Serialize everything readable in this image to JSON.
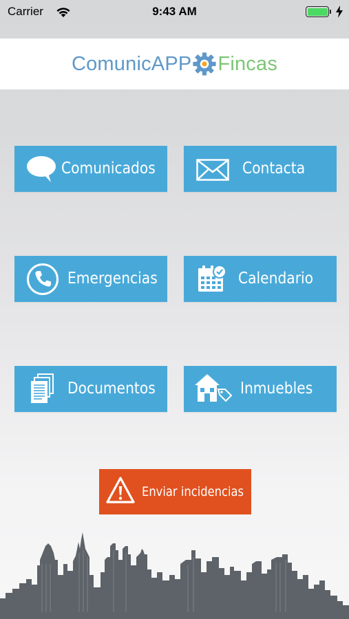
{
  "status_bar": {
    "carrier": "Carrier",
    "time": "9:43 AM",
    "battery_level": 1.0
  },
  "header": {
    "logo_left": "ComunicAPP",
    "logo_right": "Fincas",
    "logo_colors": {
      "left": "#5f98c9",
      "gear": "#5f98c9",
      "right": "#7cc576"
    }
  },
  "menu": {
    "button_color": "#48a9d9",
    "items": [
      {
        "label": "Comunicados",
        "icon": "speech-bubble-icon"
      },
      {
        "label": "Contacta",
        "icon": "envelope-icon"
      },
      {
        "label": "Emergencias",
        "icon": "phone-icon"
      },
      {
        "label": "Calendario",
        "icon": "calendar-icon"
      },
      {
        "label": "Documentos",
        "icon": "documents-icon"
      },
      {
        "label": "Inmuebles",
        "icon": "house-tag-icon"
      }
    ]
  },
  "incidents": {
    "label": "Enviar incidencias",
    "icon": "warning-icon",
    "color": "#e0511f"
  },
  "footer": {
    "skyline_color": "#5d6368"
  }
}
